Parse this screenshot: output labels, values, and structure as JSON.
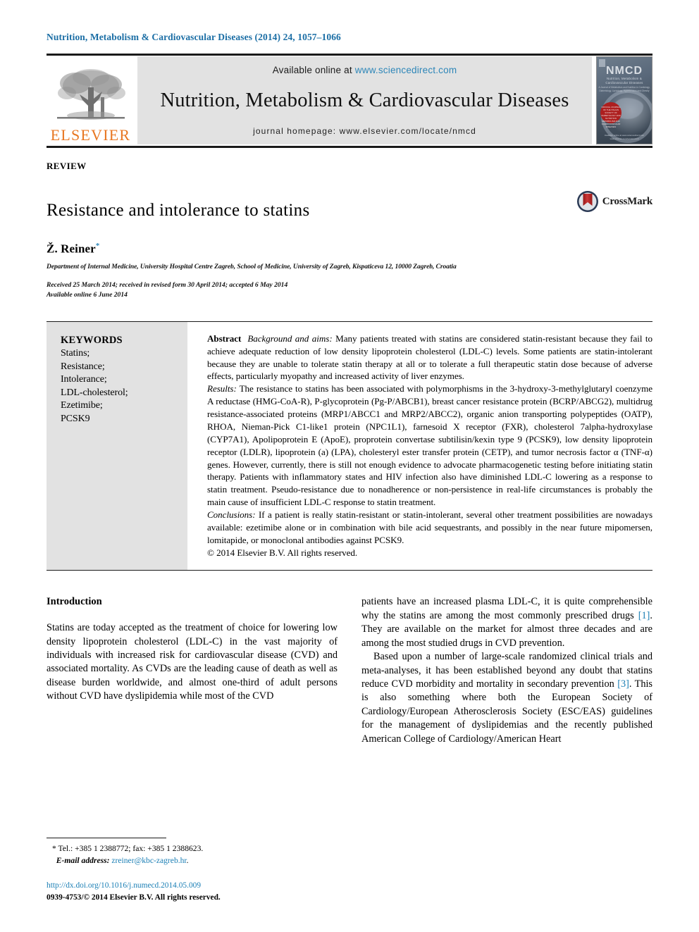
{
  "running_head": "Nutrition, Metabolism & Cardiovascular Diseases (2014) 24, 1057–1066",
  "masthead": {
    "publisher_name": "ELSEVIER",
    "available_prefix": "Available online at ",
    "sciencedirect_url": "www.sciencedirect.com",
    "journal_title": "Nutrition, Metabolism & Cardiovascular Diseases",
    "homepage": "journal homepage: www.elsevier.com/locate/nmcd",
    "cover": {
      "acronym": "NMCD",
      "subtitle": "Nutrition, Metabolism &\nCardiovascular Diseases",
      "tagline": "A Journal of Metabolism and Nutrition in Cardiology,\nDiabetology, Lipidology, Hypertension and Obesity",
      "badge_text": "OFFICIAL JOURNAL OF THE ITALIAN SOCIETY OF DIABETOLOGY AND NUTRITION METABOLISM AND CARDIOVASCULAR DISEASES",
      "footer": "Available online at\nwww.sciencedirect.com\nwww.elsevier.com/locate/nmcd"
    }
  },
  "article": {
    "section_label": "REVIEW",
    "title": "Resistance and intolerance to statins",
    "crossmark_label": "CrossMark",
    "author": "Ž. Reiner",
    "author_marker": "*",
    "affiliation": "Department of Internal Medicine, University Hospital Centre Zagreb, School of Medicine, University of Zagreb, Kispaticeva 12, 10000 Zagreb, Croatia",
    "history_line1": "Received 25 March 2014; received in revised form 30 April 2014; accepted 6 May 2014",
    "history_line2": "Available online 6 June 2014"
  },
  "keywords": {
    "heading": "KEYWORDS",
    "items": [
      "Statins;",
      "Resistance;",
      "Intolerance;",
      "LDL-cholesterol;",
      "Ezetimibe;",
      "PCSK9"
    ]
  },
  "abstract": {
    "label": "Abstract",
    "background_label": "Background and aims:",
    "background_text": " Many patients treated with statins are considered statin-resistant because they fail to achieve adequate reduction of low density lipoprotein cholesterol (LDL-C) levels. Some patients are statin-intolerant because they are unable to tolerate statin therapy at all or to tolerate a full therapeutic statin dose because of adverse effects, particularly myopathy and increased activity of liver enzymes.",
    "results_label": "Results:",
    "results_text": " The resistance to statins has been associated with polymorphisms in the 3-hydroxy-3-methylglutaryl coenzyme A reductase (HMG-CoA-R), P-glycoprotein (Pg-P/ABCB1), breast cancer resistance protein (BCRP/ABCG2), multidrug resistance-associated proteins (MRP1/ABCC1 and MRP2/ABCC2), organic anion transporting polypeptides (OATP), RHOA, Nieman-Pick C1-like1 protein (NPC1L1), farnesoid X receptor (FXR), cholesterol 7alpha-hydroxylase (CYP7A1), Apolipoprotein E (ApoE), proprotein convertase subtilisin/kexin type 9 (PCSK9), low density lipoprotein receptor (LDLR), lipoprotein (a) (LPA), cholesteryl ester transfer protein (CETP), and tumor necrosis factor α (TNF-α) genes. However, currently, there is still not enough evidence to advocate pharmacogenetic testing before initiating statin therapy. Patients with inflammatory states and HIV infection also have diminished LDL-C lowering as a response to statin treatment. Pseudo-resistance due to nonadherence or non-persistence in real-life circumstances is probably the main cause of insufficient LDL-C response to statin treatment.",
    "conclusions_label": "Conclusions:",
    "conclusions_text": " If a patient is really statin-resistant or statin-intolerant, several other treatment possibilities are nowadays available: ezetimibe alone or in combination with bile acid sequestrants, and possibly in the near future mipomersen, lomitapide, or monoclonal antibodies against PCSK9.",
    "copyright": "© 2014 Elsevier B.V. All rights reserved."
  },
  "introduction": {
    "heading": "Introduction",
    "left_para1": "Statins are today accepted as the treatment of choice for lowering low density lipoprotein cholesterol (LDL-C) in the vast majority of individuals with increased risk for cardiovascular disease (CVD) and associated mortality. As CVDs are the leading cause of death as well as disease burden worldwide, and almost one-third of adult persons without CVD have dyslipidemia while most of the CVD",
    "right_para1_a": "patients have an increased plasma LDL-C, it is quite comprehensible why the statins are among the most commonly prescribed drugs ",
    "right_para1_ref": "[1]",
    "right_para1_b": ". They are available on the market for almost three decades and are among the most studied drugs in CVD prevention.",
    "right_para2_a": "Based upon a number of large-scale randomized clinical trials and meta-analyses, it has been established beyond any doubt that statins reduce CVD morbidity and mortality in secondary prevention ",
    "right_para2_ref": "[3]",
    "right_para2_b": ". This is also something where both the European Society of Cardiology/European Atherosclerosis Society (ESC/EAS) guidelines for the management of dyslipidemias and the recently published American College of Cardiology/American Heart"
  },
  "footnote": {
    "tel_line": "* Tel.: +385 1 2388772; fax: +385 1 2388623.",
    "email_label": "E-mail address:",
    "email": "zreiner@kbc-zagreb.hr",
    "email_trailing": "."
  },
  "colophon": {
    "doi": "http://dx.doi.org/10.1016/j.numecd.2014.05.009",
    "issn_line": "0939-4753/© 2014 Elsevier B.V. All rights reserved."
  },
  "colors": {
    "link": "#1b7fb5",
    "sciencedirect": "#2d86b8",
    "elsevier_orange": "#E87722",
    "running_head": "#1b6ea5"
  }
}
